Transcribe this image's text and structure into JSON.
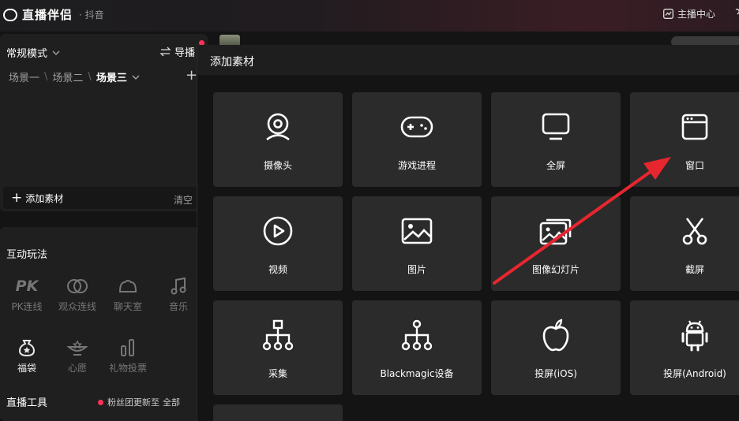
{
  "app": {
    "title": "直播伴侣",
    "platform": "· 抖音",
    "host_center": "主播中心"
  },
  "sidebar": {
    "mode": "常规模式",
    "guide": "导播",
    "scenes": [
      "场景一",
      "场景二",
      "场景三"
    ],
    "add_material": "添加素材",
    "clear": "清空",
    "interactive_title": "互动玩法",
    "tools": [
      {
        "label": "PK连线",
        "icon": "pk-icon"
      },
      {
        "label": "观众连线",
        "icon": "link-rings-icon"
      },
      {
        "label": "聊天室",
        "icon": "chat-room-icon"
      },
      {
        "label": "音乐",
        "icon": "music-icon"
      },
      {
        "label": "福袋",
        "icon": "lucky-bag-icon"
      },
      {
        "label": "心愿",
        "icon": "wish-lamp-icon"
      },
      {
        "label": "礼物投票",
        "icon": "vote-bars-icon"
      }
    ],
    "live_tools_title": "直播工具",
    "fans_update": "粉丝团更新至",
    "all": "全部"
  },
  "dialog": {
    "title": "添加素材",
    "items": [
      {
        "label": "摄像头",
        "icon": "webcam-icon"
      },
      {
        "label": "游戏进程",
        "icon": "gamepad-icon"
      },
      {
        "label": "全屏",
        "icon": "monitor-icon"
      },
      {
        "label": "窗口",
        "icon": "window-icon"
      },
      {
        "label": "视频",
        "icon": "play-circle-icon"
      },
      {
        "label": "图片",
        "icon": "image-icon"
      },
      {
        "label": "图像幻灯片",
        "icon": "slideshow-icon"
      },
      {
        "label": "截屏",
        "icon": "scissors-icon"
      },
      {
        "label": "采集",
        "icon": "capture-tree-icon"
      },
      {
        "label": "Blackmagic设备",
        "icon": "blackmagic-tree-icon"
      },
      {
        "label": "投屏(iOS)",
        "icon": "apple-icon"
      },
      {
        "label": "投屏(Android)",
        "icon": "android-icon"
      }
    ]
  },
  "colors": {
    "accent_red": "#ff3355",
    "arrow_red": "#e8262f",
    "tile_bg": "#2b2b2b"
  }
}
